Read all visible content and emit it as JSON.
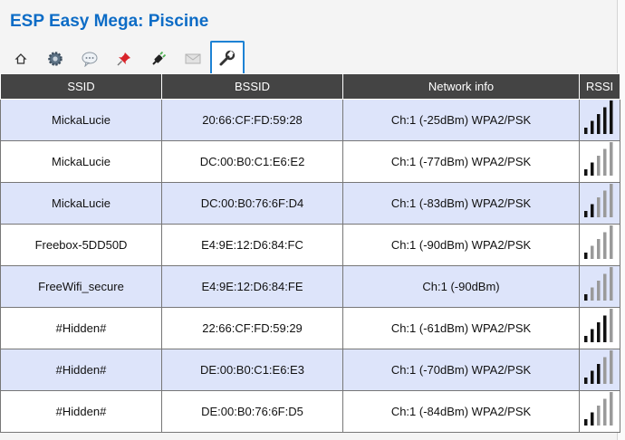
{
  "header": {
    "title": "ESP Easy Mega: Piscine"
  },
  "tabs": [
    {
      "icon": "home-icon",
      "active": false
    },
    {
      "icon": "gear-icon",
      "active": false
    },
    {
      "icon": "speech-bubble-icon",
      "active": false
    },
    {
      "icon": "pushpin-icon",
      "active": false
    },
    {
      "icon": "plug-icon",
      "active": false
    },
    {
      "icon": "envelope-icon",
      "active": false
    },
    {
      "icon": "wrench-icon",
      "active": true
    }
  ],
  "table": {
    "headers": {
      "ssid": "SSID",
      "bssid": "BSSID",
      "network": "Network info",
      "rssi": "RSSI"
    },
    "rows": [
      {
        "ssid": "MickaLucie",
        "bssid": "20:66:CF:FD:59:28",
        "network": "Ch:1 (-25dBm) WPA2/PSK",
        "signal_bars": 5
      },
      {
        "ssid": "MickaLucie",
        "bssid": "DC:00:B0:C1:E6:E2",
        "network": "Ch:1 (-77dBm) WPA2/PSK",
        "signal_bars": 2
      },
      {
        "ssid": "MickaLucie",
        "bssid": "DC:00:B0:76:6F:D4",
        "network": "Ch:1 (-83dBm) WPA2/PSK",
        "signal_bars": 2
      },
      {
        "ssid": "Freebox-5DD50D",
        "bssid": "E4:9E:12:D6:84:FC",
        "network": "Ch:1 (-90dBm) WPA2/PSK",
        "signal_bars": 1
      },
      {
        "ssid": "FreeWifi_secure",
        "bssid": "E4:9E:12:D6:84:FE",
        "network": "Ch:1 (-90dBm)",
        "signal_bars": 1
      },
      {
        "ssid": "#Hidden#",
        "bssid": "22:66:CF:FD:59:29",
        "network": "Ch:1 (-61dBm) WPA2/PSK",
        "signal_bars": 4
      },
      {
        "ssid": "#Hidden#",
        "bssid": "DE:00:B0:C1:E6:E3",
        "network": "Ch:1 (-70dBm) WPA2/PSK",
        "signal_bars": 3
      },
      {
        "ssid": "#Hidden#",
        "bssid": "DE:00:B0:76:6F:D5",
        "network": "Ch:1 (-84dBm) WPA2/PSK",
        "signal_bars": 2
      }
    ]
  },
  "colors": {
    "title": "#0d6cc6",
    "tab_active_border": "#1d82d4",
    "header_bg": "#444444",
    "row_odd": "#dde4fa",
    "row_even": "#ffffff",
    "bar_on": "#111111",
    "bar_off": "#9a9a9a"
  }
}
